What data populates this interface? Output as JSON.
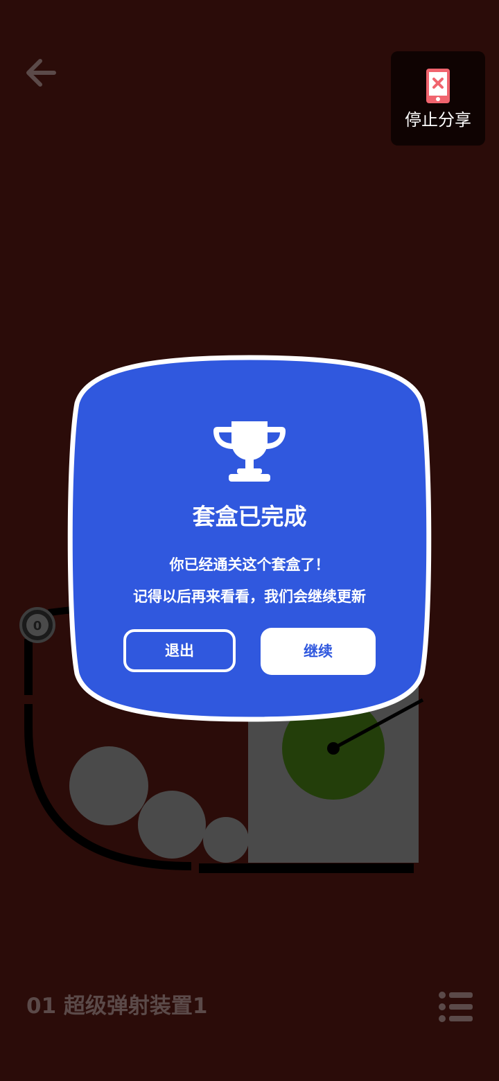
{
  "header": {
    "back_icon": "arrow-left-icon",
    "share_icon": "phone-x-icon",
    "share_label": "停止分享"
  },
  "game": {
    "counter_value": "0",
    "level_name": "01 超级弹射装置1",
    "menu_icon": "list-icon"
  },
  "dialog": {
    "icon": "trophy-icon",
    "title": "套盒已完成",
    "line1": "你已经通关这个套盒了！",
    "line2": "记得以后再来看看，我们会继续更新",
    "exit_label": "退出",
    "continue_label": "继续"
  },
  "colors": {
    "background": "#2b0c09",
    "dialog_blue": "#3058de",
    "dark_gray": "#4a4a4a",
    "green_target": "#233e0a",
    "share_red": "#f0646e"
  }
}
